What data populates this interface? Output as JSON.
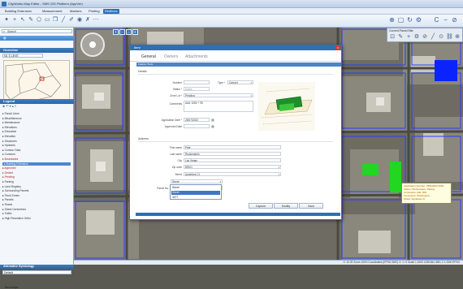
{
  "app": {
    "title": "CityWorks Map Editor - SMS GIS Platform (AppVer)",
    "quick_search_placeholder": "Quick Search (Ctrl+Q)"
  },
  "ribbon_tabs": [
    "Building Extension",
    "Measurement",
    "Markers",
    "Printing",
    "Redlines"
  ],
  "ribbon_active": 4,
  "sidebar": {
    "search_label": "Search",
    "section_overview": "Overview",
    "input_value": "N1 S  LEVE",
    "legend_label": "Legend",
    "layers": [
      {
        "label": "Parcel Lines",
        "style": "normal"
      },
      {
        "label": "Miscellaneous",
        "style": "normal"
      },
      {
        "label": "Maintenance",
        "style": "normal"
      },
      {
        "label": "Elevations",
        "style": "normal"
      },
      {
        "label": "Education",
        "style": "normal"
      },
      {
        "label": "Elevation",
        "style": "normal"
      },
      {
        "label": "Structures",
        "style": "normal"
      },
      {
        "label": "Hydrants",
        "style": "normal"
      },
      {
        "label": "Contour Data",
        "style": "normal"
      },
      {
        "label": "Contours",
        "style": "normal"
      },
      {
        "label": "Boundaries",
        "style": "red"
      },
      {
        "label": "Building Extension",
        "style": "highlight"
      },
      {
        "label": "Approved",
        "style": "red"
      },
      {
        "label": "Denied",
        "style": "red"
      },
      {
        "label": "Pending",
        "style": "red"
      },
      {
        "label": "Parking",
        "style": "normal"
      },
      {
        "label": "Land Registry",
        "style": "normal"
      },
      {
        "label": "Surrounding Parcels",
        "style": "normal"
      },
      {
        "label": "Flood Zones",
        "style": "normal"
      },
      {
        "label": "Parcels",
        "style": "normal"
      },
      {
        "label": "Roads",
        "style": "normal"
      },
      {
        "label": "Street Centerlines",
        "style": "normal"
      },
      {
        "label": "Traffic",
        "style": "normal"
      },
      {
        "label": "High Resolution Ortho",
        "style": "normal"
      }
    ],
    "bottom_header": "Alternative Symbology",
    "bottom_input": "Default",
    "bottom_item": "Basemaps"
  },
  "dialog": {
    "title": "Item",
    "tabs": [
      "General",
      "Owners",
      "Attachments"
    ],
    "bar_label": "Feature  Tools",
    "section1": "Details",
    "fields": [
      {
        "label": "Number",
        "value": ""
      },
      {
        "label": "Status *",
        "value": "Active"
      },
      {
        "label": "Zone Lot *",
        "value": "Pending"
      },
      {
        "label": "Comments",
        "value": "Add: 1050 + 95"
      },
      {
        "label": "Application Date *",
        "value": "25/07/2022"
      },
      {
        "label": "Approved Date",
        "value": ""
      }
    ],
    "type_label": "Type *",
    "type_value": "Carport",
    "section2": "Address",
    "address": [
      {
        "label": "First name",
        "value": "Pete"
      },
      {
        "label": "Last name",
        "value": "Ruckenstein"
      },
      {
        "label": "City",
        "value": "Las Vegas"
      },
      {
        "label": "Zip code",
        "value": "89101"
      },
      {
        "label": "Street",
        "value": "Appletree Ct"
      },
      {
        "label": "Street no.",
        "value": "Street"
      },
      {
        "label": "Parcel No.",
        "value": ""
      }
    ],
    "dropdown_options": [
      "Street",
      "Street",
      "4477"
    ],
    "dropdown_selected": 1,
    "buttons": [
      "Capture",
      "Modify",
      "Save"
    ]
  },
  "popup": {
    "lines": [
      "Application Number: PRN/2022 0002",
      "Owner: Ruckenstein, Dieting",
      "Comments: Add. 50ft",
      "Comments: Worthington",
      "Street: Appletree Ct"
    ]
  },
  "parcel_tools": {
    "header": "Current Parcel Site"
  },
  "status": "X: 10.25 Zoom 100%   Coordinates (EPSG:3857)   X: 1 / 0   Scale 1:1500   1255.654 4591.2   1:1500   EPSG",
  "colors": {
    "accent": "#2e6fb5",
    "highlight_building": "#22d622",
    "blue_building": "#0b23ff",
    "parcel_line": "#2a3dff"
  }
}
